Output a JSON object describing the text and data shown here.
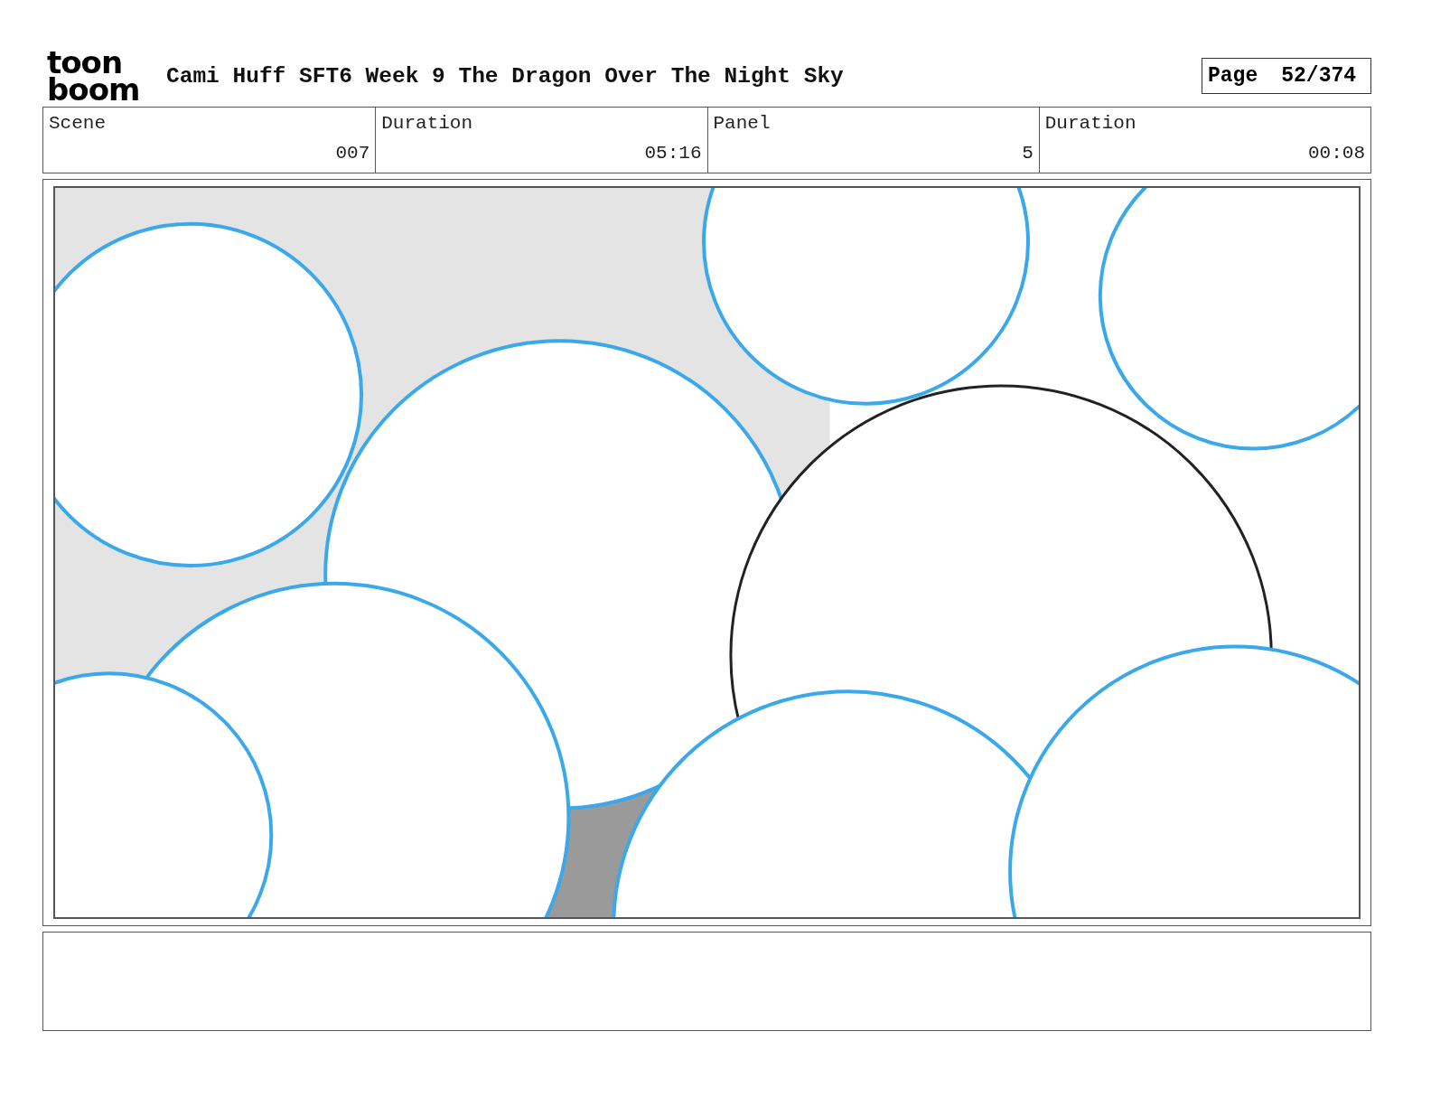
{
  "header": {
    "logo": [
      "toon",
      "boom"
    ],
    "title": "Cami Huff SFT6 Week 9 The Dragon Over The Night Sky",
    "page_label": "Page",
    "page_number": "52/374"
  },
  "info_table": {
    "columns": [
      "Scene",
      "Duration",
      "Panel",
      "Duration"
    ],
    "values": [
      "007",
      "05:16",
      "5",
      "00:08"
    ]
  }
}
